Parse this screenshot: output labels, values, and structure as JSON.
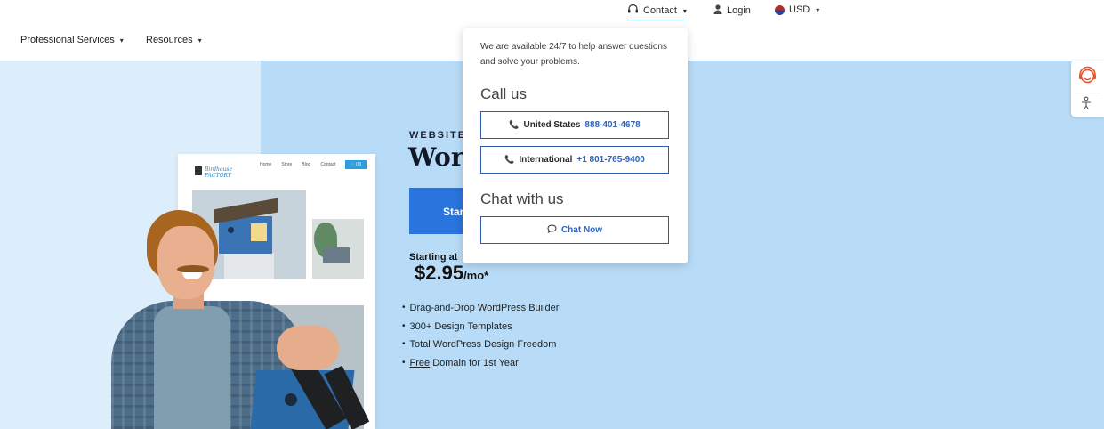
{
  "utility_bar": {
    "contact_label": "Contact",
    "login_label": "Login",
    "currency_label": "USD"
  },
  "main_nav": {
    "items": [
      {
        "label": "Professional Services"
      },
      {
        "label": "Resources"
      }
    ]
  },
  "hero": {
    "eyebrow": "WEBSITE",
    "headline": "Wor",
    "cta_label": "Star",
    "starting_label": "Starting at",
    "price": "$2.95",
    "price_suffix": "/mo*",
    "features": [
      {
        "text": "Drag-and-Drop WordPress Builder"
      },
      {
        "text": "300+ Design Templates"
      },
      {
        "text": "Total WordPress Design Freedom"
      },
      {
        "prefix": "Free",
        "text": " Domain for 1st Year"
      }
    ],
    "mock_site": {
      "logo_line1": "Birdhouse",
      "logo_line2": "FACTORY",
      "nav": [
        "Home",
        "Store",
        "Blog",
        "Contact"
      ],
      "cart": "(0)"
    }
  },
  "contact_dropdown": {
    "intro": "We are available 24/7 to help answer questions and solve your problems.",
    "call_heading": "Call us",
    "us_label": "United States",
    "us_number": "888-401-4678",
    "intl_label": "International",
    "intl_number": "+1 801-765-9400",
    "chat_heading": "Chat with us",
    "chat_button": "Chat Now"
  },
  "colors": {
    "hero_bg": "#b8dcf7",
    "hero_left_band": "#dcedfb",
    "cta_blue": "#2a74de",
    "link_blue": "#2e63c2",
    "support_icon_orange": "#e8542a"
  },
  "icons": {
    "contact": "headset-icon",
    "login": "user-icon",
    "currency": "us-flag-icon",
    "phone": "phone-icon",
    "chat": "chat-bubble-icon",
    "side_support": "support-agent-icon",
    "side_accessibility": "accessibility-icon"
  }
}
